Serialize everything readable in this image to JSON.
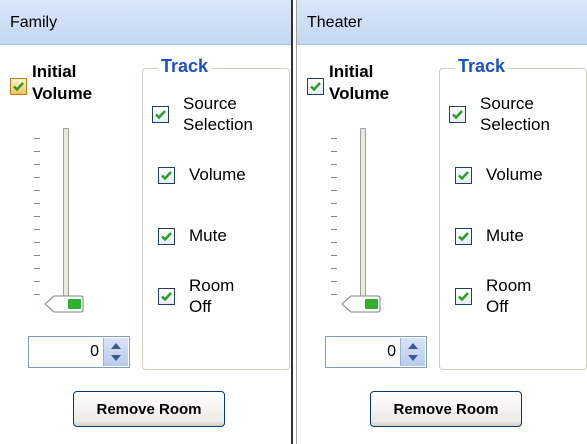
{
  "rooms": [
    {
      "name": "Family",
      "initial_volume_label": "Initial Volume",
      "initial_volume_checked": true,
      "slider_value": 0,
      "spin_value": "0",
      "track_legend": "Track",
      "track_options": [
        {
          "label": "Source Selection",
          "checked": true
        },
        {
          "label": "Volume",
          "checked": true
        },
        {
          "label": "Mute",
          "checked": true
        },
        {
          "label": "Room Off",
          "checked": true
        }
      ],
      "remove_label": "Remove Room"
    },
    {
      "name": "Theater",
      "initial_volume_label": "Initial Volume",
      "initial_volume_checked": true,
      "slider_value": 0,
      "spin_value": "0",
      "track_legend": "Track",
      "track_options": [
        {
          "label": "Source Selection",
          "checked": true
        },
        {
          "label": "Volume",
          "checked": true
        },
        {
          "label": "Mute",
          "checked": true
        },
        {
          "label": "Room Off",
          "checked": true
        }
      ],
      "remove_label": "Remove Room"
    }
  ],
  "colors": {
    "header_bg": "#c8daf2",
    "track_legend": "#1a50d0",
    "check_mark": "#21a121",
    "initial_check_bg": "#f4c15e",
    "slider_thumb": "#2fb12f"
  }
}
